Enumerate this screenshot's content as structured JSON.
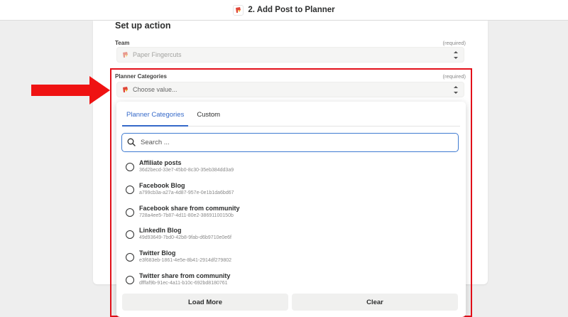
{
  "header": {
    "title": "2. Add Post to Planner",
    "app_icon": "planner-app-icon"
  },
  "section": {
    "title": "Set up action"
  },
  "team_field": {
    "label": "Team",
    "required": "(required)",
    "value": "Paper Fingercuts"
  },
  "categories_field": {
    "label": "Planner Categories",
    "required": "(required)",
    "placeholder": "Choose value..."
  },
  "dropdown": {
    "tabs": [
      {
        "label": "Planner Categories",
        "active": true
      },
      {
        "label": "Custom",
        "active": false
      }
    ],
    "search_placeholder": "Search ...",
    "options": [
      {
        "name": "Affiliate posts",
        "id": "36d2becd-33e7-45b0-8c30-35eb384dd3a9"
      },
      {
        "name": "Facebook Blog",
        "id": "a799cb3a-a27a-4d87-957e-0e1b1da6bd67"
      },
      {
        "name": "Facebook share from community",
        "id": "728a4ee5-7b87-4d11-80e2-38691100150b"
      },
      {
        "name": "LinkedIn Blog",
        "id": "49d93649-7bd0-42b8-9fab-d6b9710e0e6f"
      },
      {
        "name": "Twitter Blog",
        "id": "e3f683eb-1861-4e5e-8b41-2914df279802"
      },
      {
        "name": "Twitter share from community",
        "id": "dfffaf9b-91ec-4a11-b10c-692bd8180761"
      }
    ],
    "load_more_label": "Load More",
    "clear_label": "Clear"
  },
  "colors": {
    "accent": "#3569c9",
    "highlight": "#e3101a",
    "arrow": "#ef1212"
  }
}
